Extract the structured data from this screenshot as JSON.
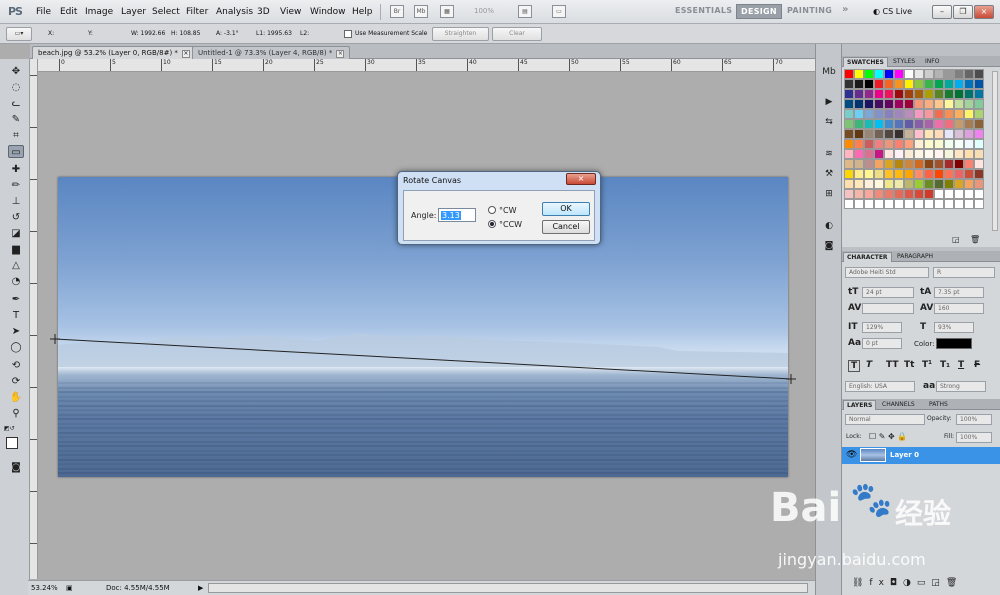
{
  "menubar": {
    "logo": "PS",
    "items": [
      "File",
      "Edit",
      "Image",
      "Layer",
      "Select",
      "Filter",
      "Analysis",
      "3D",
      "View",
      "Window",
      "Help"
    ],
    "zoom": "100%",
    "workspaces": [
      "ESSENTIALS",
      "DESIGN",
      "PAINTING"
    ],
    "more": "»",
    "cslive": "CS Live"
  },
  "options": {
    "x_label": "X:",
    "y_label": "Y:",
    "w": "W: 1992.66",
    "h": "H: 108.85",
    "a": "A: -3.1°",
    "l1": "L1: 1995.63",
    "l2": "L2:",
    "use_scale": "Use Measurement Scale",
    "straighten": "Straighten",
    "clear": "Clear"
  },
  "tabs": [
    {
      "title": "beach.jpg @ 53.2% (Layer 0, RGB/8#) *",
      "close": "×"
    },
    {
      "title": "Untitled-1 @ 73.3% (Layer 4, RGB/8) *",
      "close": "×"
    }
  ],
  "ruler": {
    "h_labels": [
      "0",
      "5",
      "10",
      "15",
      "20",
      "25",
      "30",
      "35",
      "40",
      "45",
      "50",
      "55",
      "60",
      "65",
      "70"
    ]
  },
  "status": {
    "zoom": "53.24%",
    "doc": "Doc: 4.55M/4.55M"
  },
  "swatches_tabs": [
    "SWATCHES",
    "STYLES",
    "INFO"
  ],
  "swatch_colors": [
    "#ff0000",
    "#ffff00",
    "#00ff00",
    "#00ffff",
    "#0000ff",
    "#ff00ff",
    "#ffffff",
    "#e6e6e6",
    "#cccccc",
    "#b3b3b3",
    "#999999",
    "#808080",
    "#666666",
    "#4d4d4d",
    "#333333",
    "#1a1a1a",
    "#000000",
    "#ed1c24",
    "#f26522",
    "#f7941d",
    "#fff200",
    "#8dc63f",
    "#39b54a",
    "#00a651",
    "#00a99d",
    "#00aeef",
    "#0072bc",
    "#0054a6",
    "#2e3192",
    "#662d91",
    "#92278f",
    "#ec008c",
    "#ed145b",
    "#9e0b0f",
    "#a0410d",
    "#a3620a",
    "#aba000",
    "#598527",
    "#1a7b30",
    "#007236",
    "#00746b",
    "#0076a3",
    "#004b80",
    "#003471",
    "#1b1464",
    "#440e62",
    "#630460",
    "#9e005d",
    "#9e0039",
    "#f7977a",
    "#f9ad81",
    "#fdc68a",
    "#fff79a",
    "#c4df9b",
    "#a3d39c",
    "#82ca9c",
    "#7accc8",
    "#6dcff6",
    "#7da7d9",
    "#8393ca",
    "#8781bd",
    "#a186be",
    "#bd8cbf",
    "#f49ac2",
    "#f6989d",
    "#f26c4f",
    "#f68e56",
    "#fbaf5c",
    "#fff467",
    "#acd372",
    "#7cc576",
    "#3bb878",
    "#1abbb4",
    "#00bff3",
    "#438ccb",
    "#5574b9",
    "#605ca8",
    "#855fa8",
    "#a763a8",
    "#f06ea9",
    "#f26d7d",
    "#c69c6d",
    "#a67c52",
    "#8c6239",
    "#754c24",
    "#603913",
    "#998675",
    "#736357",
    "#534741",
    "#362f2d",
    "#c7b299",
    "#ffc0cb",
    "#ffe4b5",
    "#ffdab9",
    "#e6e6fa",
    "#d8bfd8",
    "#dda0dd",
    "#ee82ee",
    "#ff8c00",
    "#ff7f50",
    "#cd5c5c",
    "#f08080",
    "#e9967a",
    "#fa8072",
    "#ffa07a",
    "#ffefd5",
    "#fffacd",
    "#fafad2",
    "#f0fff0",
    "#f5fffa",
    "#f0f8ff",
    "#e0ffff",
    "#ffb6c1",
    "#ff69b4",
    "#db7093",
    "#c71585",
    "#ffe4e1",
    "#fff0f5",
    "#faebd7",
    "#fdf5e6",
    "#fffaf0",
    "#fff5ee",
    "#f5f5dc",
    "#ffe4c4",
    "#ffdead",
    "#f5deb3",
    "#deb887",
    "#d2b48c",
    "#bc8f8f",
    "#f4a460",
    "#daa520",
    "#b8860b",
    "#cd853f",
    "#d2691e",
    "#8b4513",
    "#a0522d",
    "#a52a2a",
    "#800000",
    "#fa8072",
    "#ffe4e1",
    "#ffd700",
    "#ffec8b",
    "#fff68f",
    "#eedd82",
    "#ffc125",
    "#ffb90f",
    "#ffa500",
    "#ff8c69",
    "#ff6347",
    "#ff4500",
    "#ff7256",
    "#ee6363",
    "#cd4f39",
    "#8b3626",
    "#ffdead",
    "#ffe7ba",
    "#ffefdb",
    "#fff8dc",
    "#f0e68c",
    "#eee8aa",
    "#bdb76b",
    "#9acd32",
    "#6b8e23",
    "#556b2f",
    "#808000",
    "#daa520",
    "#f4a460",
    "#e9967a",
    "#f4c2c2",
    "#f4b6a6",
    "#f7a79b",
    "#f08a7a",
    "#eb7a6a",
    "#e46a5a",
    "#dd5a4a",
    "#d64a3a",
    "#cf3a2a",
    "#ffffff",
    "#ffffff",
    "#ffffff",
    "#ffffff",
    "#ffffff",
    "#ffffff",
    "#ffffff",
    "#ffffff",
    "#ffffff",
    "#ffffff",
    "#ffffff",
    "#ffffff",
    "#ffffff",
    "#ffffff",
    "#ffffff",
    "#ffffff",
    "#ffffff",
    "#ffffff",
    "#ffffff"
  ],
  "character": {
    "tabs": [
      "CHARACTER",
      "PARAGRAPH"
    ],
    "font": "Adobe Heiti Std",
    "style": "R",
    "size": "24 pt",
    "leading": "7.35 pt",
    "tracking": "160",
    "vscale": "129%",
    "hscale": "93%",
    "baseline": "0 pt",
    "color_label": "Color:",
    "language": "English: USA",
    "aa_label": "a",
    "aa": "Strong",
    "type_buttons": [
      "T",
      "T",
      "TT",
      "Tt",
      "T¹",
      "T₁",
      "T",
      "F"
    ]
  },
  "layers": {
    "tabs": [
      "LAYERS",
      "CHANNELS",
      "PATHS"
    ],
    "mode": "Normal",
    "opacity_label": "Opacity:",
    "opacity": "100%",
    "lock_label": "Lock:",
    "fill_label": "Fill:",
    "fill": "100%",
    "layer_name": "Layer 0"
  },
  "dialog": {
    "title": "Rotate Canvas",
    "close": "×",
    "angle_label": "Angle:",
    "angle_value": "3.13",
    "cw_label": "°CW",
    "ccw_label": "°CCW",
    "ok": "OK",
    "cancel": "Cancel"
  },
  "watermark": {
    "brand": "Bai",
    "brand2": "经验",
    "url": "jingyan.baidu.com"
  }
}
